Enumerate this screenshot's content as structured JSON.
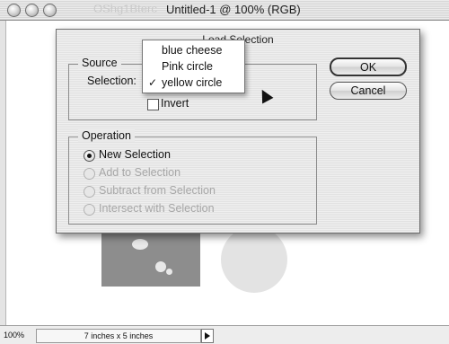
{
  "window": {
    "title": "Untitled-1 @ 100% (RGB)",
    "ghost_text": "OShg1Bterc",
    "zoom": "100%",
    "size_info": "7 inches x 5 inches"
  },
  "dialog": {
    "title": "Load Selection",
    "source_group": "Source",
    "selection_label": "Selection:",
    "invert_label": "Invert",
    "invert_checked": false,
    "operation_group": "Operation",
    "operations": [
      {
        "label": "New Selection",
        "selected": true,
        "enabled": true
      },
      {
        "label": "Add to Selection",
        "selected": false,
        "enabled": false
      },
      {
        "label": "Subtract from Selection",
        "selected": false,
        "enabled": false
      },
      {
        "label": "Intersect with Selection",
        "selected": false,
        "enabled": false
      }
    ],
    "ok_label": "OK",
    "cancel_label": "Cancel"
  },
  "popup_menu": {
    "items": [
      "blue cheese",
      "Pink circle",
      "yellow circle"
    ],
    "selected": "yellow circle",
    "check_mark": "✓"
  }
}
